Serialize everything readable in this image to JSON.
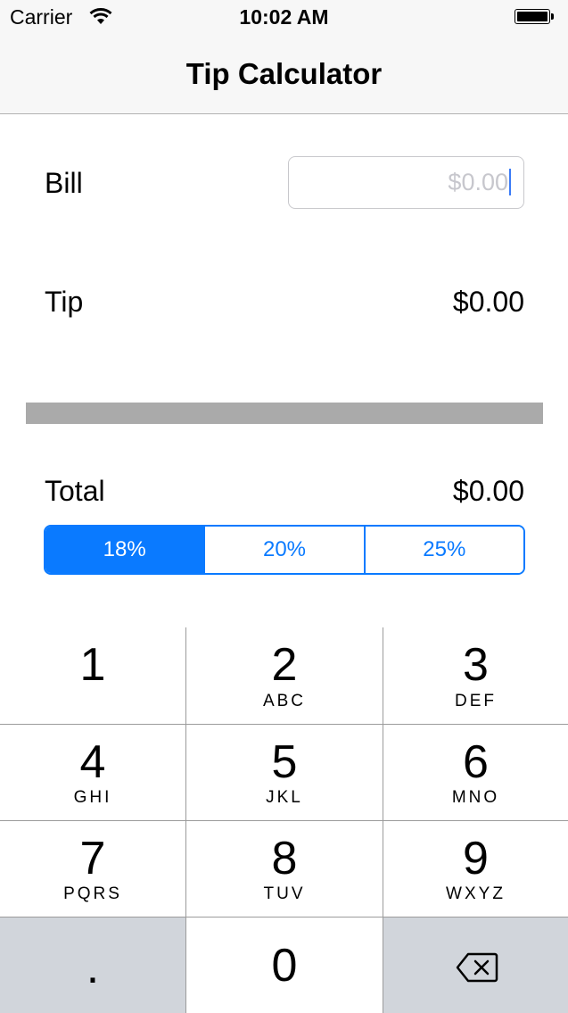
{
  "status_bar": {
    "carrier": "Carrier",
    "time": "10:02 AM"
  },
  "nav": {
    "title": "Tip Calculator"
  },
  "bill": {
    "label": "Bill",
    "placeholder": "$0.00"
  },
  "tip": {
    "label": "Tip",
    "value": "$0.00"
  },
  "total": {
    "label": "Total",
    "value": "$0.00"
  },
  "tip_options": {
    "items": [
      "18%",
      "20%",
      "25%"
    ],
    "selected": "18%"
  },
  "keypad": {
    "keys": [
      {
        "digit": "1",
        "letters": ""
      },
      {
        "digit": "2",
        "letters": "ABC"
      },
      {
        "digit": "3",
        "letters": "DEF"
      },
      {
        "digit": "4",
        "letters": "GHI"
      },
      {
        "digit": "5",
        "letters": "JKL"
      },
      {
        "digit": "6",
        "letters": "MNO"
      },
      {
        "digit": "7",
        "letters": "PQRS"
      },
      {
        "digit": "8",
        "letters": "TUV"
      },
      {
        "digit": "9",
        "letters": "WXYZ"
      },
      {
        "digit": ".",
        "letters": ""
      },
      {
        "digit": "0",
        "letters": ""
      },
      {
        "digit": "",
        "letters": "",
        "icon": "backspace-icon"
      }
    ]
  },
  "colors": {
    "accent": "#0a7aff",
    "divider": "#aaaaaa",
    "key_gray": "#d1d5db"
  }
}
